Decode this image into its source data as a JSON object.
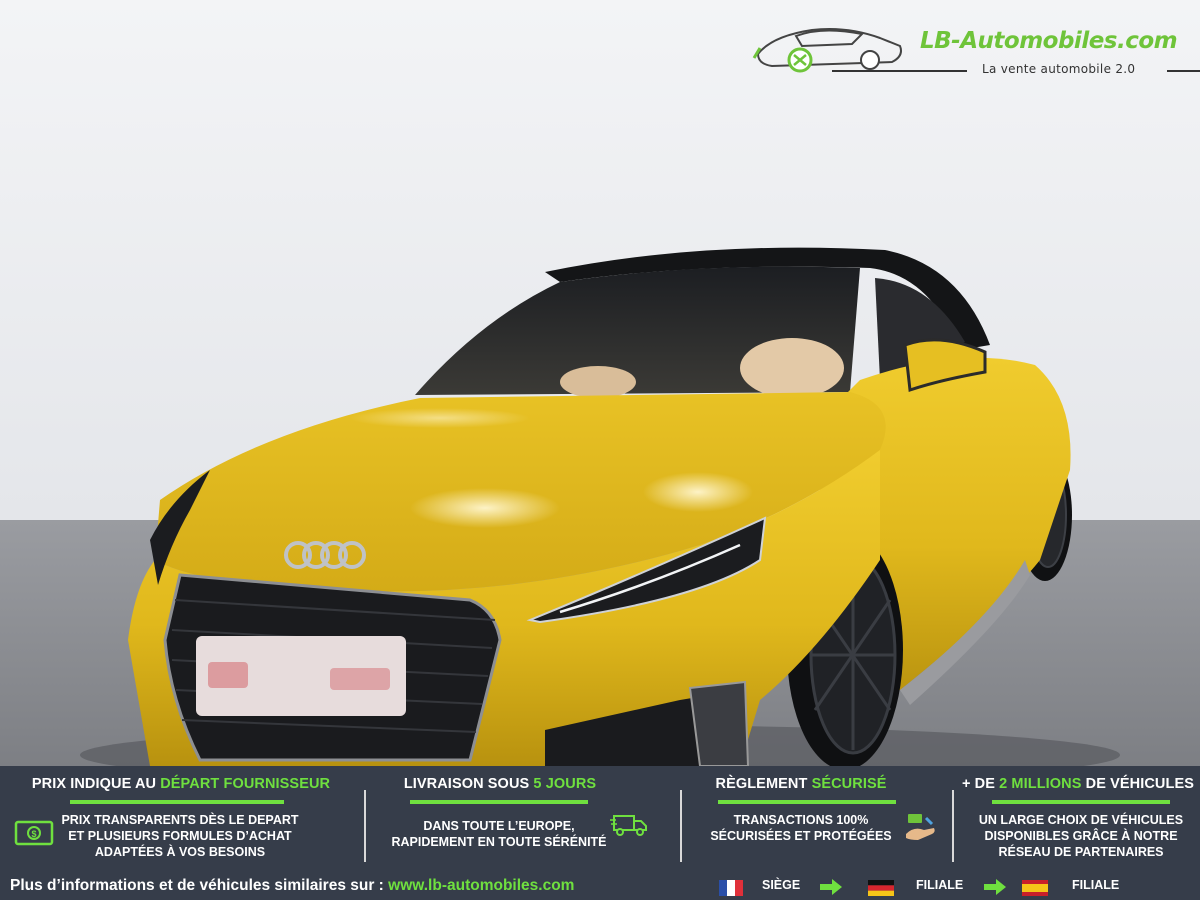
{
  "logo": {
    "brand": "LB-Automobiles.com",
    "tagline": "La vente automobile 2.0",
    "brand_color": "#6fc43a"
  },
  "photo": {
    "car_color": "#e2bb1f",
    "background_color": "#ecedf0",
    "floor_color": "#8e9095"
  },
  "banner": {
    "background_color": "#363d4a",
    "accent_color": "#6fe03f",
    "columns": [
      {
        "head_pre": "PRIX INDIQUE AU ",
        "head_accent": "DÉPART FOURNISSEUR",
        "head_post": "",
        "lines": [
          "PRIX TRANSPARENTS DÈS LE DEPART",
          "ET PLUSIEURS FORMULES D’ACHAT",
          "ADAPTÉES À VOS BESOINS"
        ],
        "icon": "money-icon"
      },
      {
        "head_pre": "LIVRAISON SOUS ",
        "head_accent": "5 JOURS",
        "head_post": "",
        "lines": [
          "DANS TOUTE L’EUROPE,",
          "RAPIDEMENT EN TOUTE SÉRÉNITÉ"
        ],
        "icon": "delivery-truck-icon"
      },
      {
        "head_pre": "RÈGLEMENT ",
        "head_accent": "SÉCURISÉ",
        "head_post": "",
        "lines": [
          "TRANSACTIONS 100%",
          "SÉCURISÉES ET PROTÉGÉES"
        ],
        "icon": "payment-hand-icon"
      },
      {
        "head_pre": "+ DE ",
        "head_accent": "2 MILLIONS",
        "head_post": " DE VÉHICULES",
        "lines": [
          "UN LARGE CHOIX DE VÉHICULES",
          "DISPONIBLES GRÂCE À NOTRE",
          "RÉSEAU DE PARTENAIRES"
        ],
        "icon": ""
      }
    ],
    "footer_text": "Plus d’informations et de véhicules similaires sur : ",
    "footer_url": "www.lb-automobiles.com",
    "locations": [
      {
        "flag": "france-flag-icon",
        "label": "SIÈGE"
      },
      {
        "flag": "germany-flag-icon",
        "label": "FILIALE"
      },
      {
        "flag": "spain-flag-icon",
        "label": "FILIALE"
      }
    ]
  }
}
